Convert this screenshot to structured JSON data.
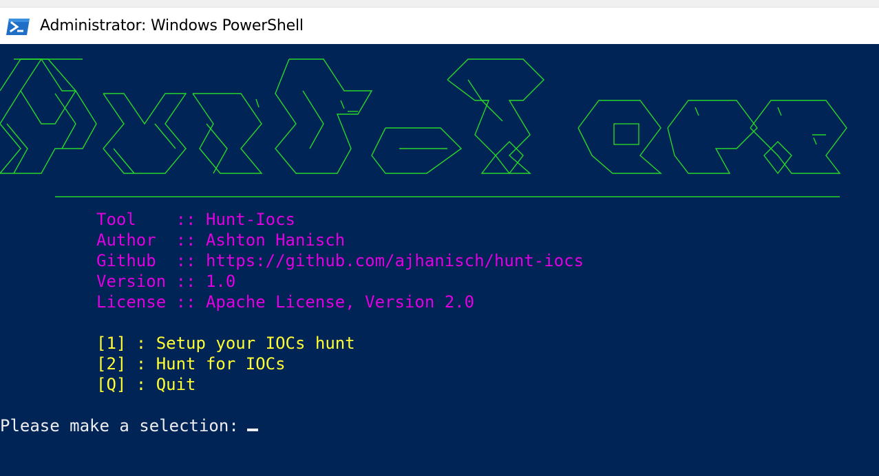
{
  "window": {
    "title": "Administrator: Windows PowerShell"
  },
  "banner": {
    "description_icon": "hunt-iocs-ascii-art-banner",
    "color": "#29d62a"
  },
  "info": {
    "lines": [
      "Tool    :: Hunt-Iocs",
      "Author  :: Ashton Hanisch",
      "Github  :: https://github.com/ajhanisch/hunt-iocs",
      "Version :: 1.0",
      "License :: Apache License, Version 2.0"
    ],
    "color": "#e000e0"
  },
  "menu": {
    "items": [
      "[1] : Setup your IOCs hunt",
      "[2] : Hunt for IOCs",
      "[Q] : Quit"
    ],
    "color": "#ffff33"
  },
  "prompt": {
    "text": "Please make a selection:"
  },
  "colors": {
    "console_background": "#012456",
    "prompt_text": "#eeedf0"
  }
}
